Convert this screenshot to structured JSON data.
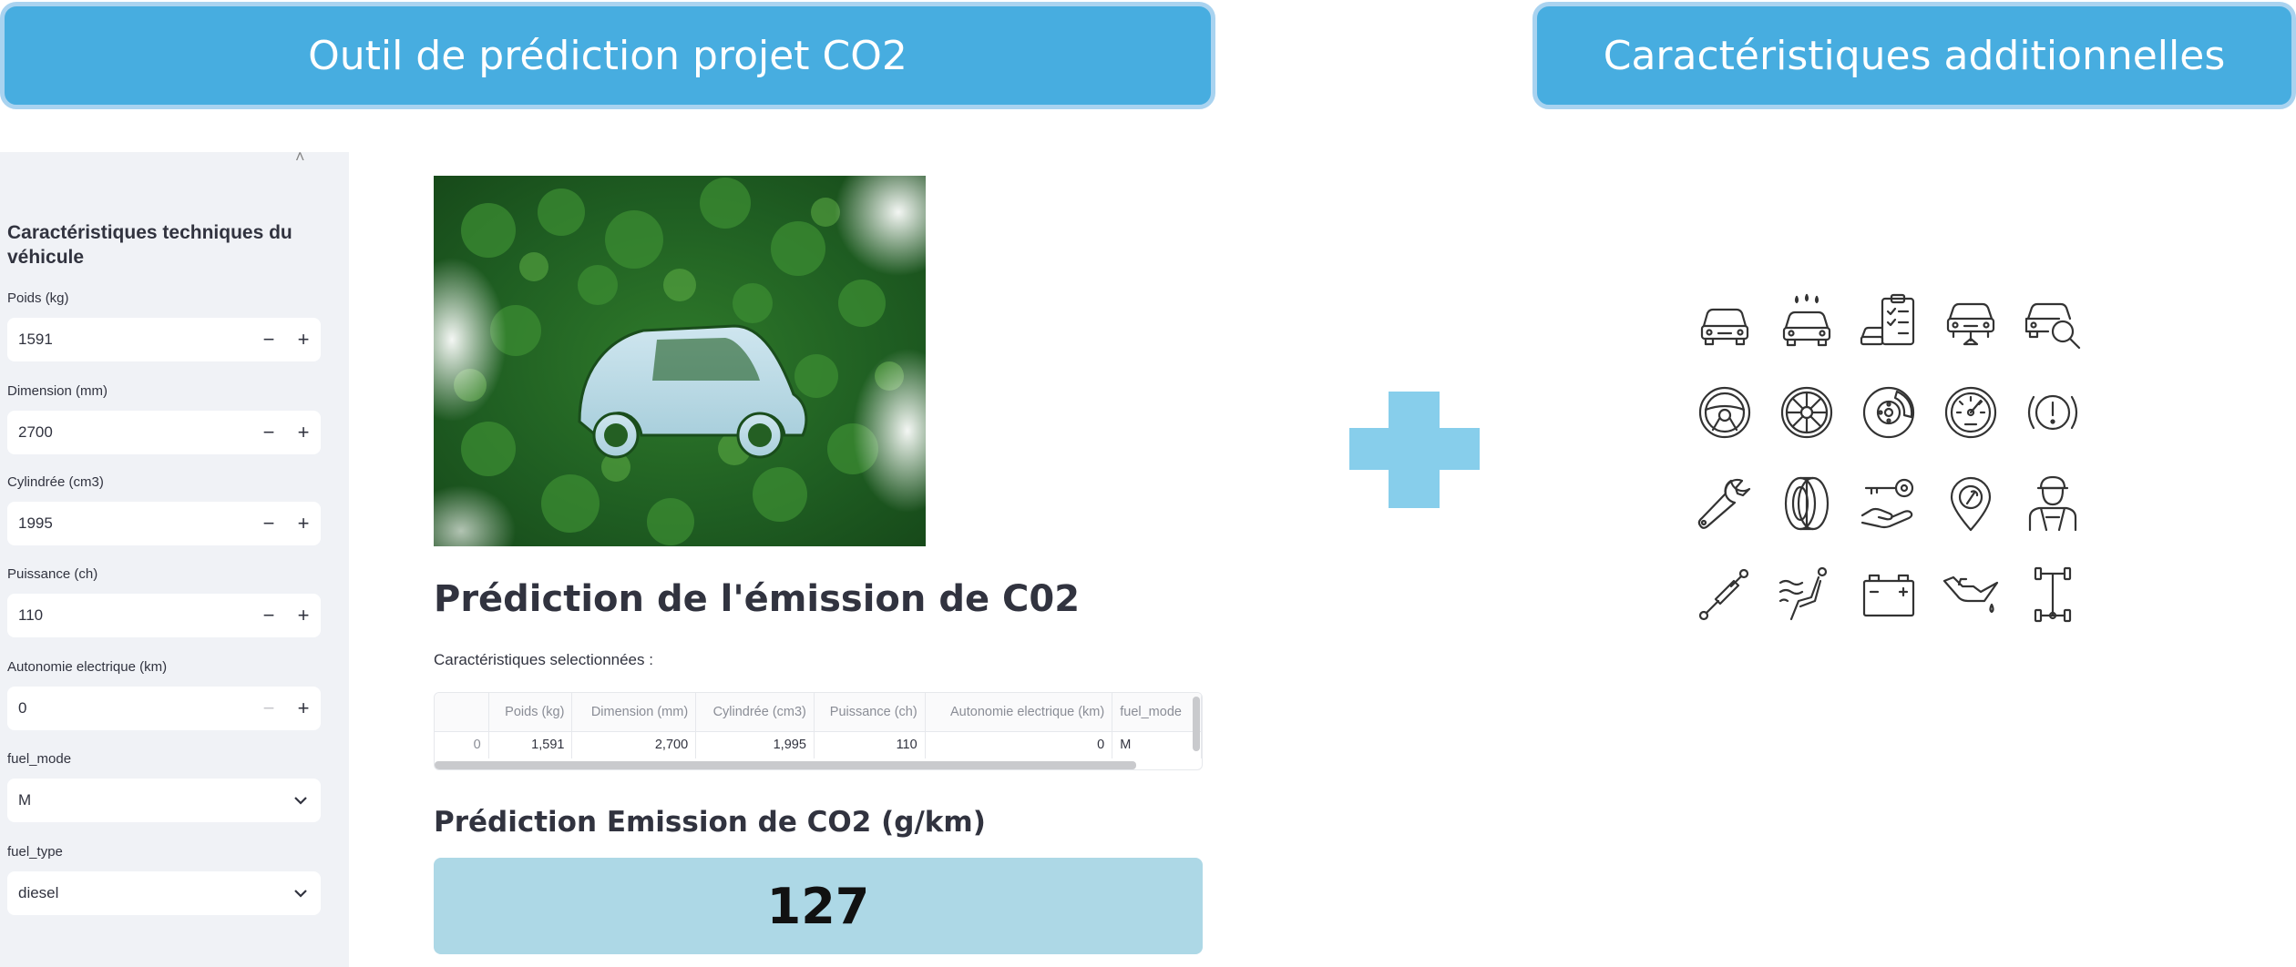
{
  "banners": {
    "left": "Outil de prédiction projet CO2",
    "right": "Caractéristiques additionnelles"
  },
  "sidebar": {
    "title": "Caractéristiques techniques du véhicule",
    "fields": [
      {
        "label": "Poids (kg)",
        "value": "1591"
      },
      {
        "label": "Dimension (mm)",
        "value": "2700"
      },
      {
        "label": "Cylindrée (cm3)",
        "value": "1995"
      },
      {
        "label": "Puissance (ch)",
        "value": "110"
      },
      {
        "label": "Autonomie electrique (km)",
        "value": "0"
      }
    ],
    "selects": [
      {
        "label": "fuel_mode",
        "value": "M"
      },
      {
        "label": "fuel_type",
        "value": "diesel"
      }
    ],
    "minus": "−",
    "plus": "+"
  },
  "main": {
    "title": "Prédiction de l'émission de C02",
    "selected_label": "Caractéristiques selectionnées :",
    "table": {
      "headers": [
        "",
        "Poids (kg)",
        "Dimension (mm)",
        "Cylindrée (cm3)",
        "Puissance (ch)",
        "Autonomie electrique (km)",
        "fuel_mode"
      ],
      "row": [
        "0",
        "1,591",
        "2,700",
        "1,995",
        "110",
        "0",
        "M"
      ]
    },
    "result_title": "Prédiction Emission de CO2 (g/km)",
    "result_value": "127"
  },
  "colors": {
    "banner": "#47ade0",
    "plus": "#87ceeb",
    "result_bg": "#add8e6",
    "sidebar_bg": "#f0f2f6"
  },
  "icons": [
    "car-front-icon",
    "car-wash-icon",
    "car-checklist-icon",
    "car-diagnostic-icon",
    "car-search-icon",
    "steering-wheel-icon",
    "wheel-rim-icon",
    "brake-disc-icon",
    "speedometer-icon",
    "brake-warning-icon",
    "wrench-icon",
    "tire-icon",
    "car-key-hand-icon",
    "service-location-icon",
    "mechanic-icon",
    "shock-absorber-icon",
    "heated-seat-icon",
    "car-battery-icon",
    "oil-can-icon",
    "axle-drivetrain-icon"
  ]
}
